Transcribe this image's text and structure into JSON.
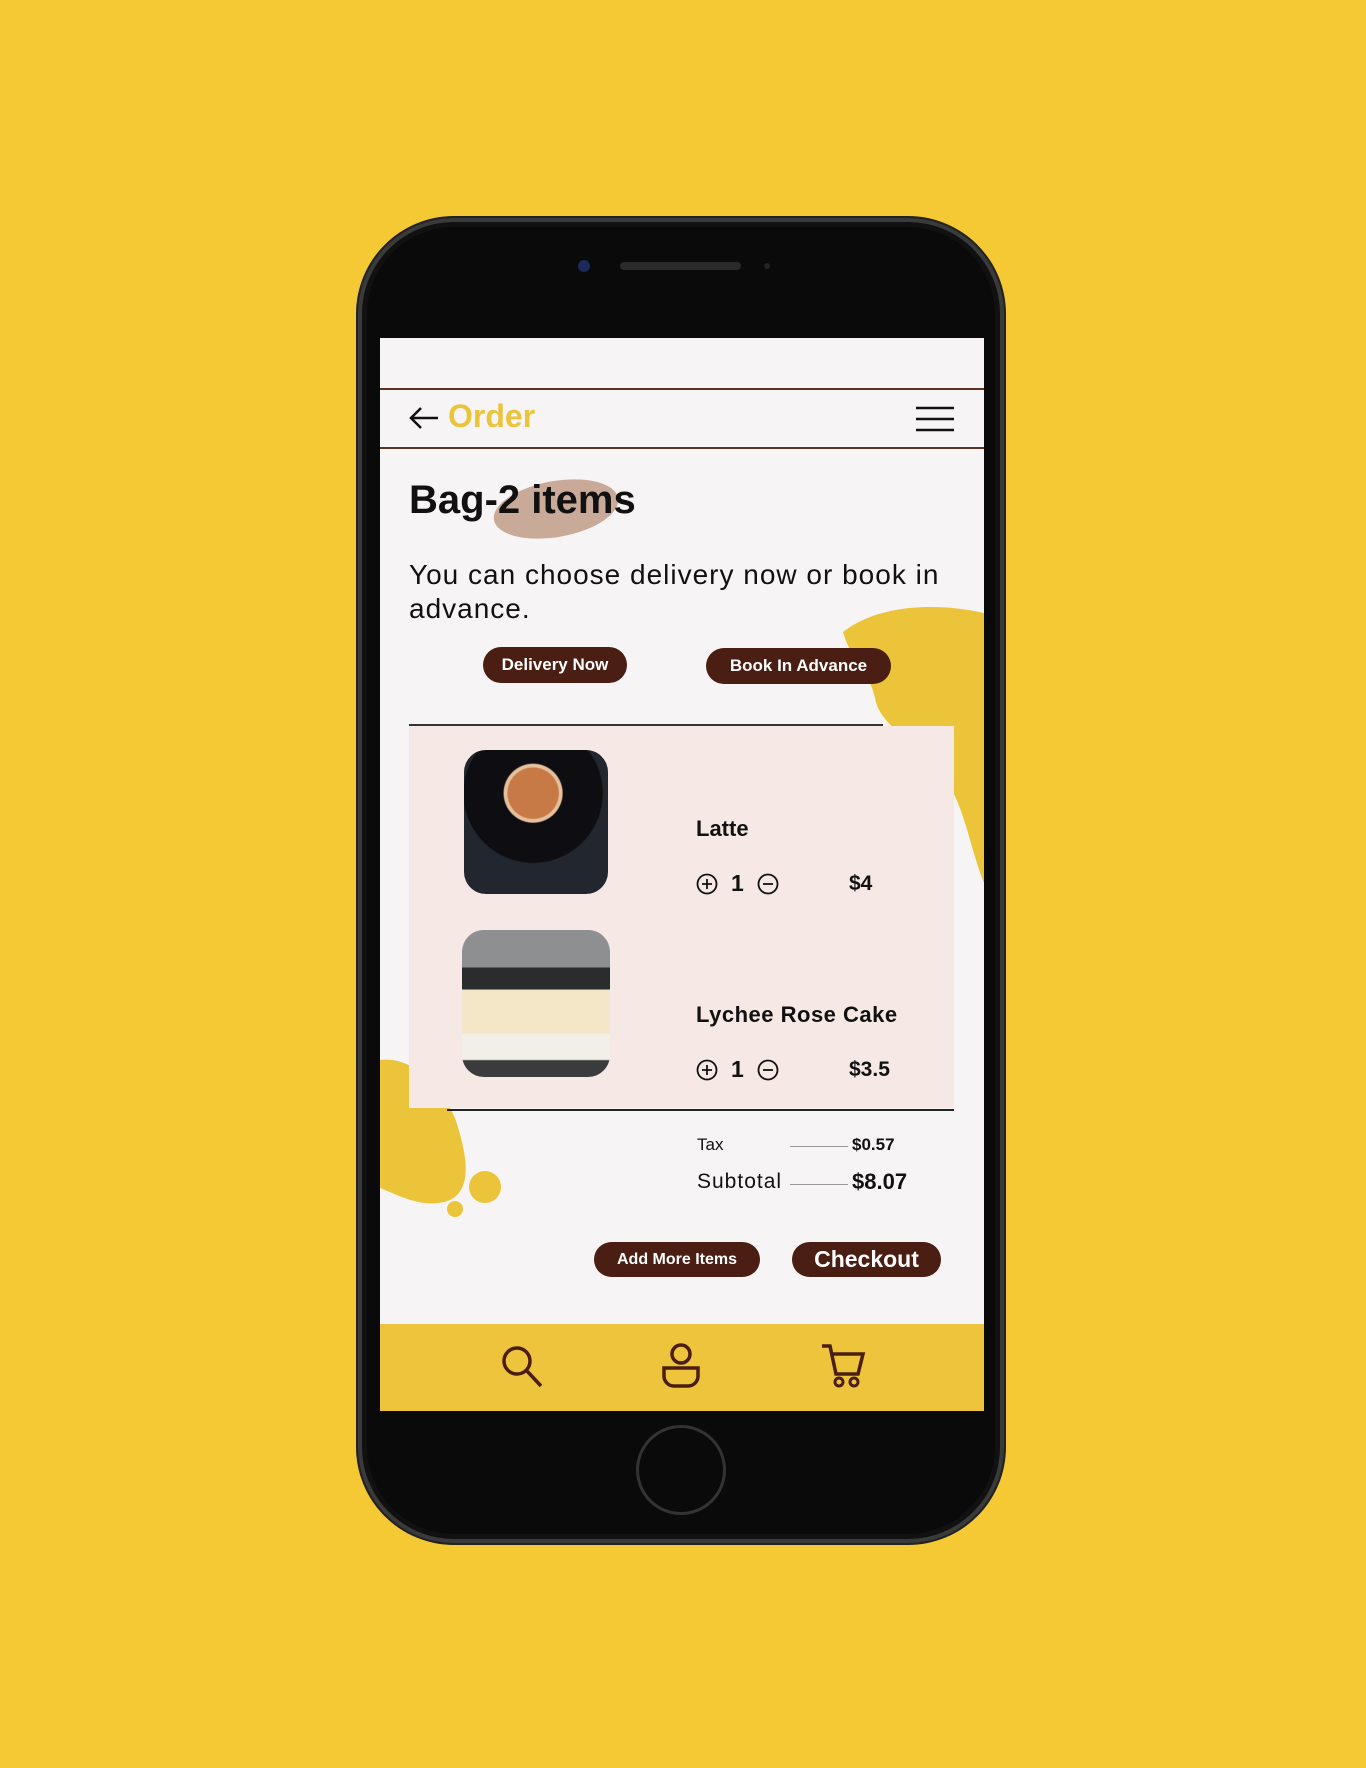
{
  "colors": {
    "background": "#F5C934",
    "accent": "#EBC43A",
    "brand_brown": "#4A1E12",
    "panel": "#F6E8E4"
  },
  "header": {
    "back_icon": "arrow-left-icon",
    "title": "Order",
    "menu_icon": "hamburger-menu-icon"
  },
  "bag": {
    "title": "Bag-2 items",
    "description": "You can choose delivery now or book in advance."
  },
  "options": {
    "delivery_now": "Delivery Now",
    "book_in_advance": "Book In Advance"
  },
  "items": [
    {
      "name": "Latte",
      "quantity": "1",
      "price": "$4",
      "image": "latte-photo"
    },
    {
      "name": "Lychee Rose Cake",
      "quantity": "1",
      "price": "$3.5",
      "image": "cake-photo"
    }
  ],
  "summary": {
    "tax_label": "Tax",
    "tax_value": "$0.57",
    "subtotal_label": "Subtotal",
    "subtotal_value": "$8.07"
  },
  "actions": {
    "add_more": "Add More Items",
    "checkout": "Checkout"
  },
  "tabbar": {
    "icons": [
      "search-icon",
      "user-icon",
      "cart-icon"
    ]
  }
}
